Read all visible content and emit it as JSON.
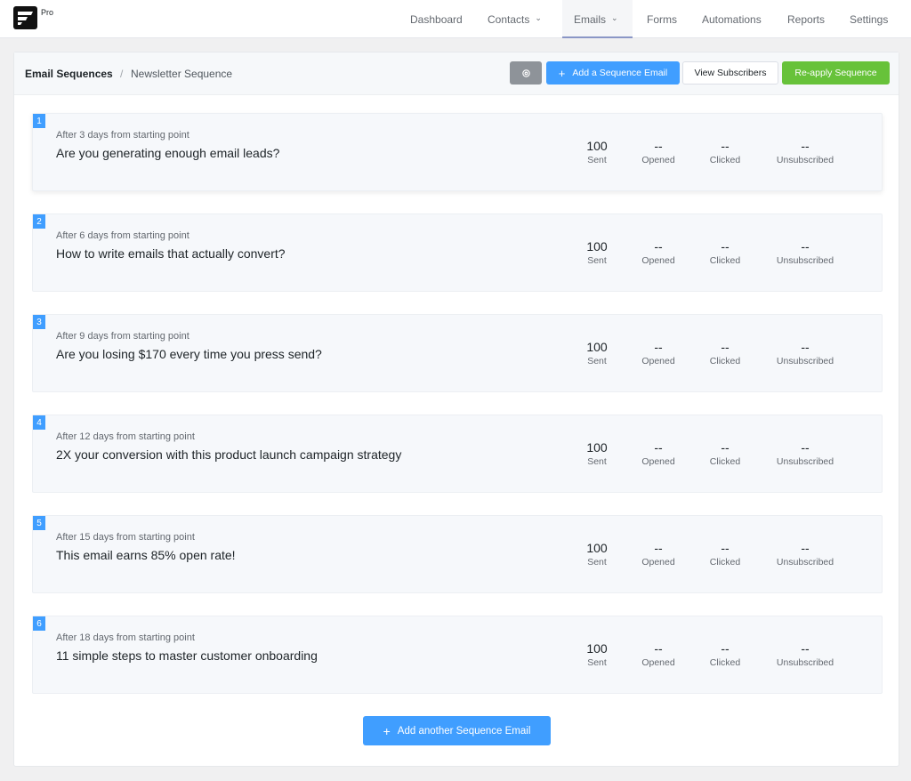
{
  "brand": {
    "pro_label": "Pro"
  },
  "nav": [
    {
      "label": "Dashboard",
      "dropdown": false,
      "active": false
    },
    {
      "label": "Contacts",
      "dropdown": true,
      "active": false
    },
    {
      "label": "Emails",
      "dropdown": true,
      "active": true
    },
    {
      "label": "Forms",
      "dropdown": false,
      "active": false
    },
    {
      "label": "Automations",
      "dropdown": false,
      "active": false
    },
    {
      "label": "Reports",
      "dropdown": false,
      "active": false
    },
    {
      "label": "Settings",
      "dropdown": false,
      "active": false
    }
  ],
  "header": {
    "breadcrumb_title": "Email Sequences",
    "breadcrumb_separator": "/",
    "breadcrumb_current": "Newsletter Sequence",
    "gear_icon": "gear-icon",
    "add_button": "Add a Sequence Email",
    "view_button": "View Subscribers",
    "reapply_button": "Re-apply Sequence"
  },
  "stat_labels": {
    "sent": "Sent",
    "opened": "Opened",
    "clicked": "Clicked",
    "unsubscribed": "Unsubscribed"
  },
  "emails": [
    {
      "number": "1",
      "delay": "After 3 days from starting point",
      "subject": "Are you generating enough email leads?",
      "sent": "100",
      "opened": "--",
      "clicked": "--",
      "unsubscribed": "--"
    },
    {
      "number": "2",
      "delay": "After 6 days from starting point",
      "subject": "How to write emails that actually convert?",
      "sent": "100",
      "opened": "--",
      "clicked": "--",
      "unsubscribed": "--"
    },
    {
      "number": "3",
      "delay": "After 9 days from starting point",
      "subject": "Are you losing $170 every time you press send?",
      "sent": "100",
      "opened": "--",
      "clicked": "--",
      "unsubscribed": "--"
    },
    {
      "number": "4",
      "delay": "After 12 days from starting point",
      "subject": "2X your conversion with this product launch campaign strategy",
      "sent": "100",
      "opened": "--",
      "clicked": "--",
      "unsubscribed": "--"
    },
    {
      "number": "5",
      "delay": "After 15 days from starting point",
      "subject": "This email earns 85% open rate!",
      "sent": "100",
      "opened": "--",
      "clicked": "--",
      "unsubscribed": "--"
    },
    {
      "number": "6",
      "delay": "After 18 days from starting point",
      "subject": "11 simple steps to master customer onboarding",
      "sent": "100",
      "opened": "--",
      "clicked": "--",
      "unsubscribed": "--"
    }
  ],
  "footer": {
    "add_another_button": "Add another Sequence Email"
  },
  "colors": {
    "primary": "#409eff",
    "success": "#67c23a",
    "gear": "#8e9399"
  }
}
